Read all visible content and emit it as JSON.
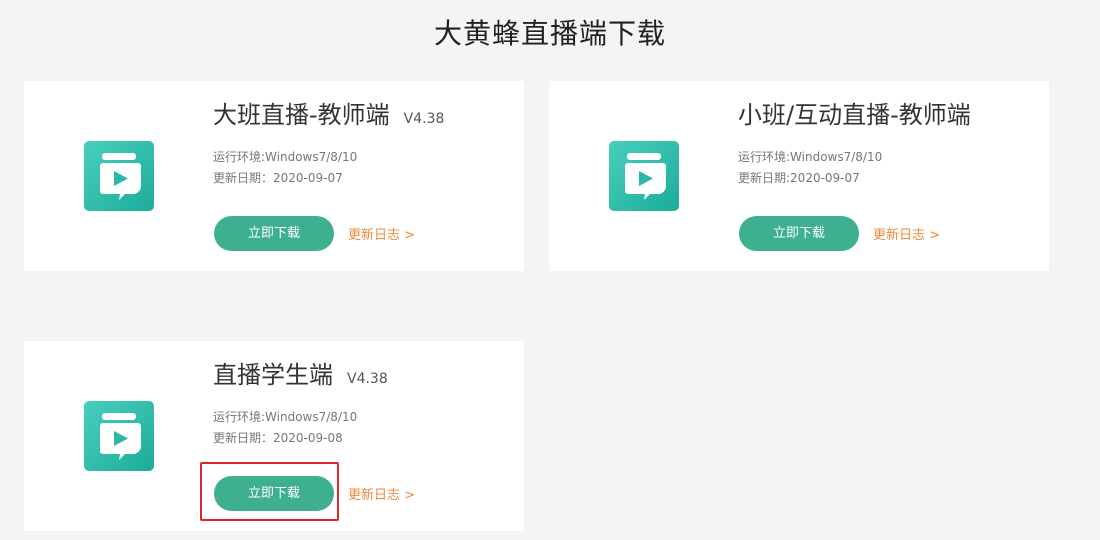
{
  "page": {
    "title": "大黄蜂直播端下载"
  },
  "products": [
    {
      "name": "大班直播-教师端",
      "version": "V4.38",
      "env": "运行环境:Windows7/8/10",
      "date": "更新日期：2020-09-07",
      "download_label": "立即下载",
      "changelog_label": "更新日志 >"
    },
    {
      "name": "小班/互动直播-教师端",
      "version": "",
      "env": "运行环境:Windows7/8/10",
      "date": "更新日期:2020-09-07",
      "download_label": "立即下载",
      "changelog_label": "更新日志 >"
    },
    {
      "name": "直播学生端",
      "version": "V4.38",
      "env": "运行环境:Windows7/8/10",
      "date": "更新日期：2020-09-08",
      "download_label": "立即下载",
      "changelog_label": "更新日志 >"
    }
  ],
  "icon": {
    "name": "app-play-book-icon",
    "color_light": "#47cdbd",
    "color_dark": "#1fae9c"
  },
  "highlight_color": "#e0262b"
}
